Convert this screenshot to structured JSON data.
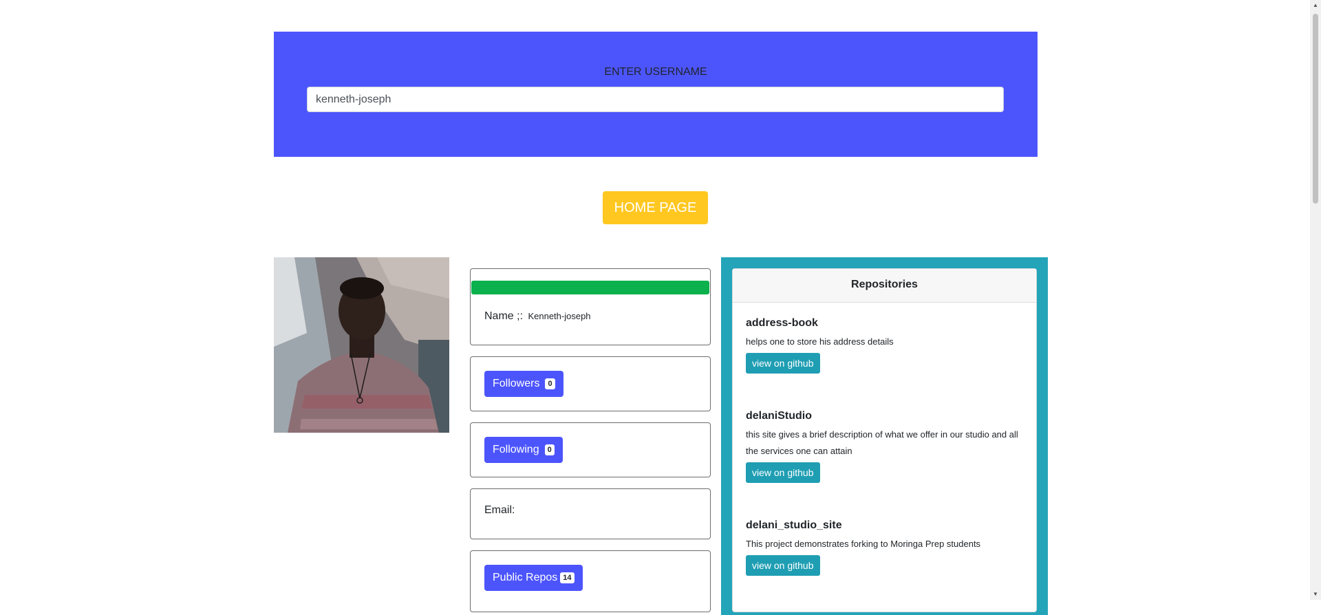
{
  "search": {
    "label": "ENTER USERNAME",
    "value": "kenneth-joseph"
  },
  "home_button": "HOME PAGE",
  "profile": {
    "avatar_alt": "profile-photo",
    "name_label": "Name ;:",
    "name_value": "Kenneth-joseph",
    "followers_label": "Followers",
    "followers_count": "0",
    "following_label": "Following",
    "following_count": "0",
    "email_label": "Email:",
    "public_repos_label": "Public Repos",
    "public_repos_count": "14"
  },
  "repositories": {
    "header": "Repositories",
    "items": [
      {
        "title": "address-book",
        "description": "helps one to store his address details",
        "button": "view on github"
      },
      {
        "title": "delaniStudio",
        "description": "this site gives a brief description of what we offer in our studio and all the services one can attain",
        "button": "view on github"
      },
      {
        "title": "delani_studio_site",
        "description": "This project demonstrates forking to Moringa Prep students",
        "button": "view on github"
      }
    ]
  },
  "colors": {
    "primary": "#4c55fc",
    "home_button": "#ffc720",
    "green_bar": "#0bb14c",
    "repo_panel": "#23a4b9"
  }
}
